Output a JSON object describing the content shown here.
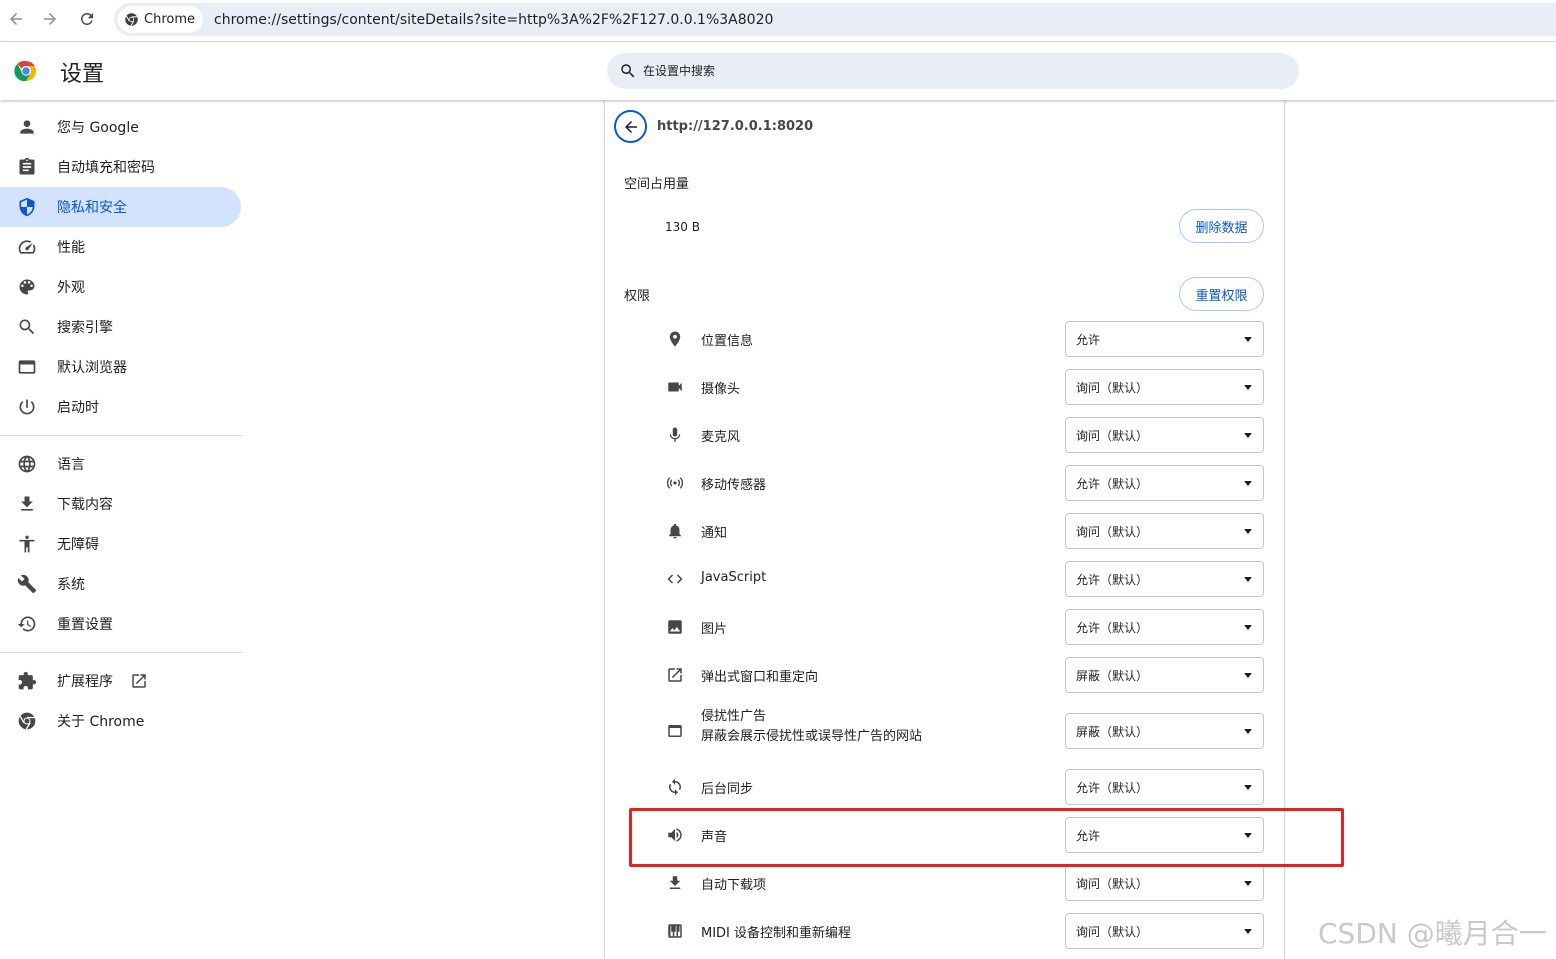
{
  "browser": {
    "chip_label": "Chrome",
    "url": "chrome://settings/content/siteDetails?site=http%3A%2F%2F127.0.0.1%3A8020"
  },
  "header": {
    "title": "设置",
    "search_placeholder": "在设置中搜索"
  },
  "sidebar": {
    "items": [
      {
        "label": "您与 Google",
        "icon": "person-icon"
      },
      {
        "label": "自动填充和密码",
        "icon": "clipboard-icon"
      },
      {
        "label": "隐私和安全",
        "icon": "shield-icon"
      },
      {
        "label": "性能",
        "icon": "speedometer-icon"
      },
      {
        "label": "外观",
        "icon": "palette-icon"
      },
      {
        "label": "搜索引擎",
        "icon": "search-icon"
      },
      {
        "label": "默认浏览器",
        "icon": "browser-icon"
      },
      {
        "label": "启动时",
        "icon": "power-icon"
      },
      {
        "label": "语言",
        "icon": "globe-icon"
      },
      {
        "label": "下载内容",
        "icon": "download-icon"
      },
      {
        "label": "无障碍",
        "icon": "accessibility-icon"
      },
      {
        "label": "系统",
        "icon": "wrench-icon"
      },
      {
        "label": "重置设置",
        "icon": "history-icon"
      },
      {
        "label": "扩展程序",
        "icon": "puzzle-icon"
      },
      {
        "label": "关于 Chrome",
        "icon": "chrome-icon"
      }
    ],
    "active_index": 2
  },
  "site": {
    "url": "http://127.0.0.1:8020",
    "usage_label": "空间占用量",
    "usage_value": "130 B",
    "delete_button": "删除数据",
    "permissions_label": "权限",
    "reset_button": "重置权限"
  },
  "permissions": [
    {
      "name": "位置信息",
      "value": "允许",
      "icon": "location-pin-icon"
    },
    {
      "name": "摄像头",
      "value": "询问（默认）",
      "icon": "camera-icon"
    },
    {
      "name": "麦克风",
      "value": "询问（默认）",
      "icon": "microphone-icon"
    },
    {
      "name": "移动传感器",
      "value": "允许（默认）",
      "icon": "sensors-icon"
    },
    {
      "name": "通知",
      "value": "询问（默认）",
      "icon": "bell-icon"
    },
    {
      "name": "JavaScript",
      "value": "允许（默认）",
      "icon": "code-icon"
    },
    {
      "name": "图片",
      "value": "允许（默认）",
      "icon": "image-icon"
    },
    {
      "name": "弹出式窗口和重定向",
      "value": "屏蔽（默认）",
      "icon": "open-in-new-icon"
    },
    {
      "name": "侵扰性广告",
      "sub": "屏蔽会展示侵扰性或误导性广告的网站",
      "value": "屏蔽（默认）",
      "icon": "ad-window-icon"
    },
    {
      "name": "后台同步",
      "value": "允许（默认）",
      "icon": "sync-icon"
    },
    {
      "name": "声音",
      "value": "允许",
      "icon": "speaker-icon"
    },
    {
      "name": "自动下载项",
      "value": "询问（默认）",
      "icon": "download-icon"
    },
    {
      "name": "MIDI 设备控制和重新编程",
      "value": "询问（默认）",
      "icon": "piano-icon"
    }
  ],
  "watermark": "CSDN @曦月合一",
  "colors": {
    "accent": "#0b57d0",
    "active_bg": "#d3e3fd",
    "highlight": "#e8211c"
  }
}
